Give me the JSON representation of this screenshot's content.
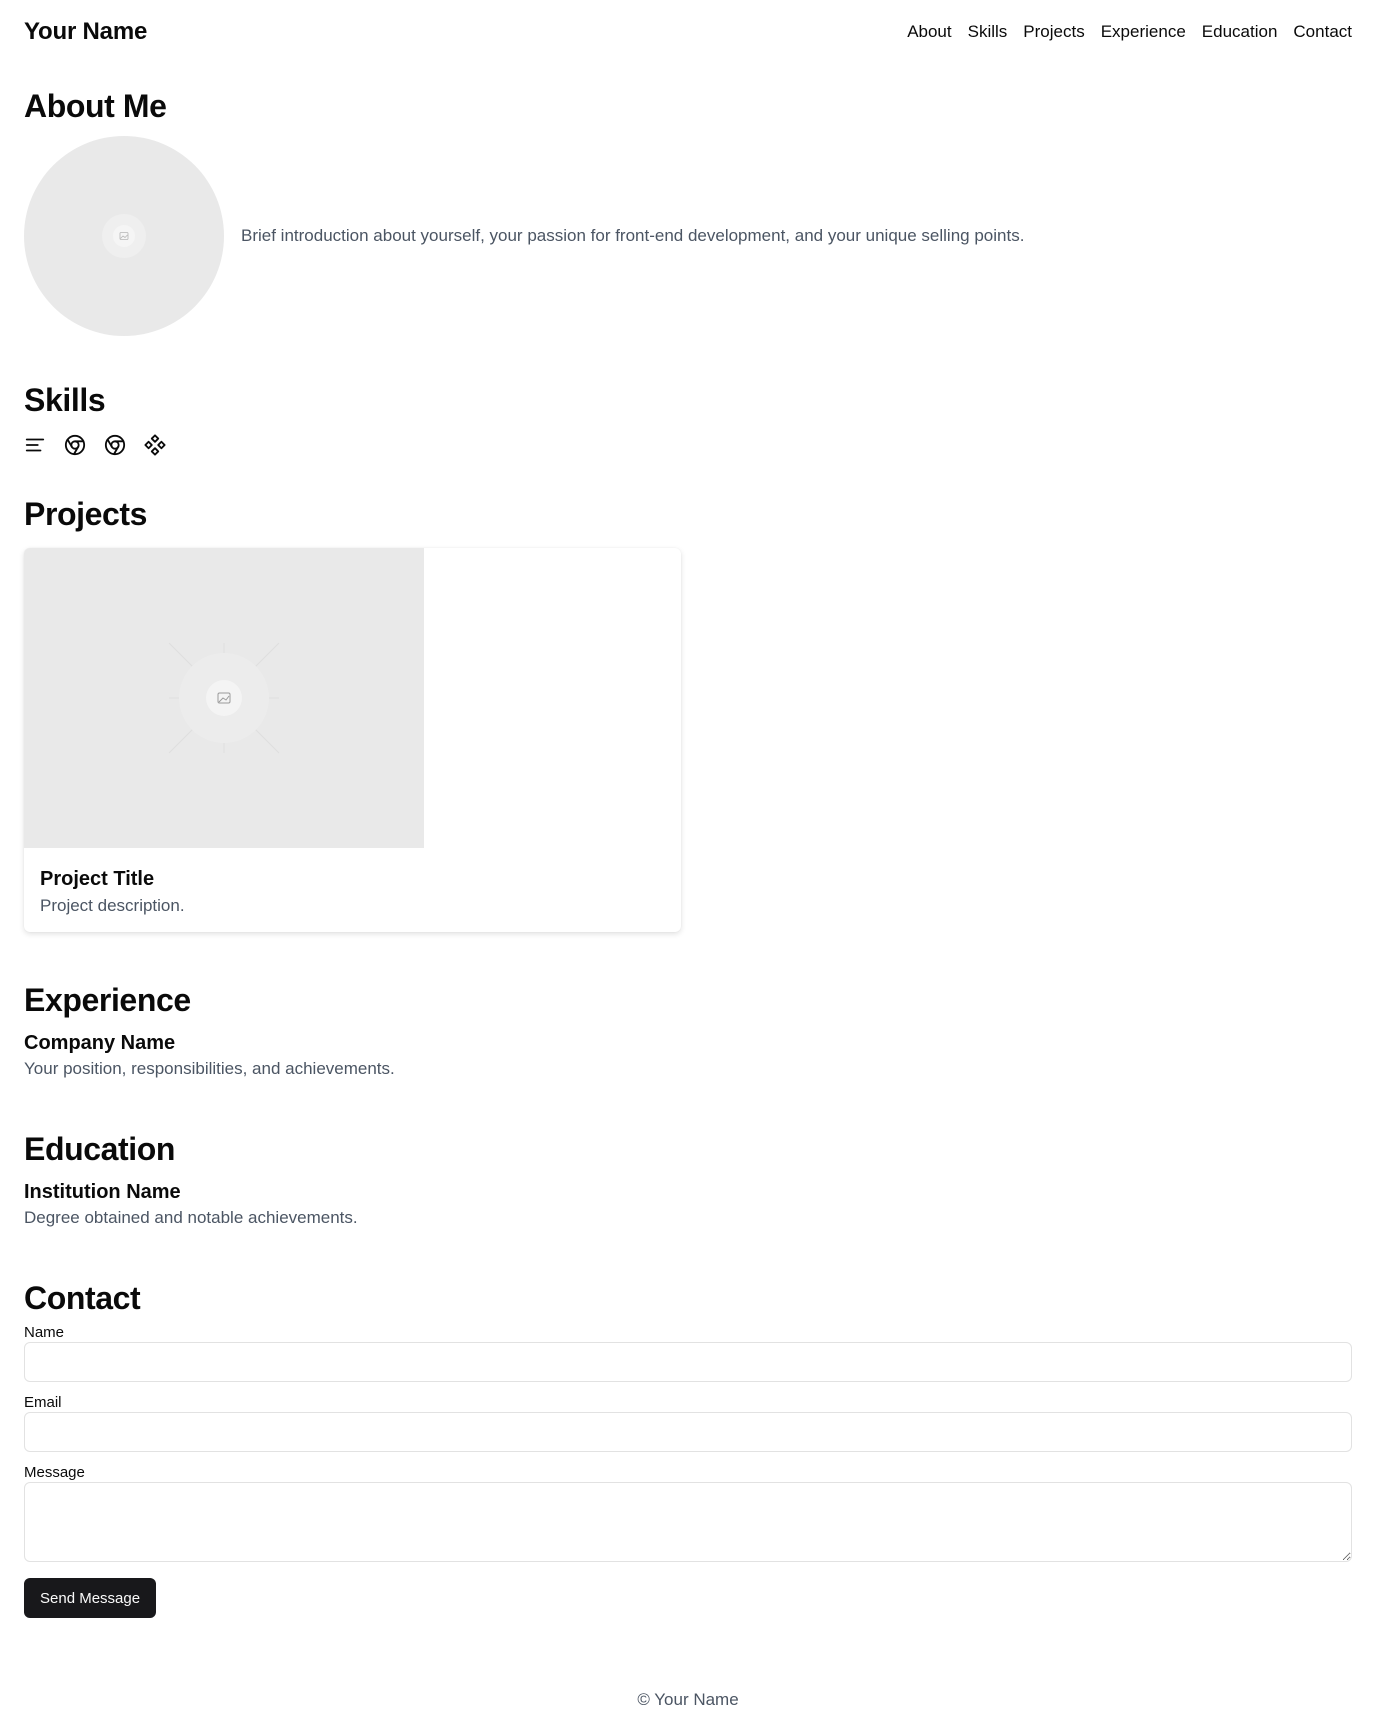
{
  "header": {
    "brand": "Your Name",
    "nav": [
      "About",
      "Skills",
      "Projects",
      "Experience",
      "Education",
      "Contact"
    ]
  },
  "about": {
    "title": "About Me",
    "avatar_icon": "image-placeholder-icon",
    "intro": "Brief introduction about yourself, your passion for front-end development, and your unique selling points."
  },
  "skills": {
    "title": "Skills",
    "icons": [
      "text-align-left-icon",
      "chrome-icon",
      "chrome-icon",
      "figma-diamond-icon"
    ]
  },
  "projects": {
    "title": "Projects",
    "items": [
      {
        "image_icon": "image-placeholder-icon",
        "title": "Project Title",
        "description": "Project description."
      }
    ]
  },
  "experience": {
    "title": "Experience",
    "items": [
      {
        "company": "Company Name",
        "details": "Your position, responsibilities, and achievements."
      }
    ]
  },
  "education": {
    "title": "Education",
    "items": [
      {
        "institution": "Institution Name",
        "details": "Degree obtained and notable achievements."
      }
    ]
  },
  "contact": {
    "title": "Contact",
    "name_label": "Name",
    "name_value": "",
    "email_label": "Email",
    "email_value": "",
    "message_label": "Message",
    "message_value": "",
    "submit_label": "Send Message"
  },
  "footer": {
    "text": "© Your Name"
  },
  "colors": {
    "text": "#0a0a0a",
    "muted_text": "#4b5563",
    "placeholder_bg": "#e9e9e9",
    "button_bg": "#18181b",
    "border": "#e2e2e2"
  }
}
